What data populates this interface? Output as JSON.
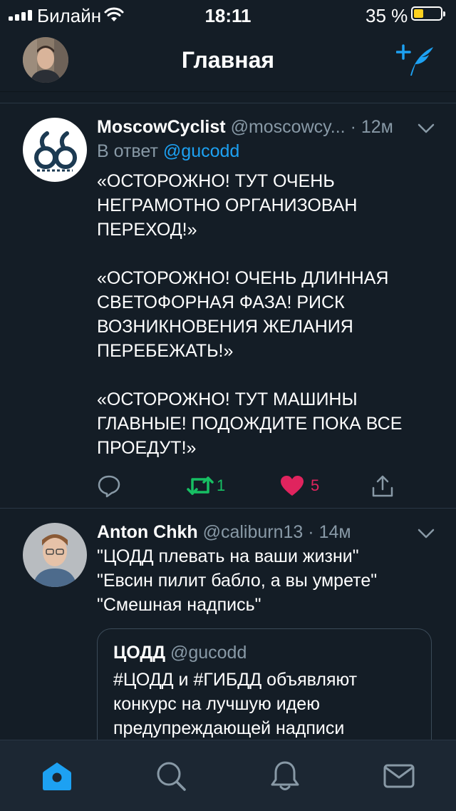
{
  "status_bar": {
    "carrier": "Билайн",
    "time": "18:11",
    "battery_percent": "35 %",
    "battery_level": 0.35,
    "battery_color": "#fdd11f"
  },
  "nav": {
    "title": "Главная",
    "profile_icon": "avatar",
    "compose_icon": "compose-tweet-icon",
    "accent": "#1da1f2"
  },
  "tweets": [
    {
      "name": "MoscowCyclist",
      "handle": "@moscowcy...",
      "time": "12м",
      "reply_prefix": "В ответ",
      "reply_to": "@gucodd",
      "paragraphs": [
        "«ОСТОРОЖНО! ТУТ ОЧЕНЬ НЕГРАМОТНО ОРГАНИЗОВАН ПЕРЕХОД!»",
        "«ОСТОРОЖНО! ОЧЕНЬ ДЛИННАЯ СВЕТОФОРНАЯ ФАЗА! РИСК ВОЗНИКНОВЕНИЯ ЖЕЛАНИЯ ПЕРЕБЕЖАТЬ!»",
        "«ОСТОРОЖНО! ТУТ МАШИНЫ ГЛАВНЫЕ! ПОДОЖДИТЕ ПОКА ВСЕ ПРОЕДУТ!»"
      ],
      "retweets": "1",
      "likes": "5"
    },
    {
      "name": "Anton Chkh",
      "handle": "@caliburn13",
      "time": "14м",
      "paragraphs": [
        "\"ЦОДД плевать на ваши жизни\"",
        "\"Евсин пилит бабло, а вы умрете\"",
        "\"Смешная надпись\""
      ],
      "quote": {
        "name": "ЦОДД",
        "handle": "@gucodd",
        "lines": [
          "#ЦОДД и #ГИБДД  объявляют",
          "конкурс на лучшую идею",
          "предупреждающей надписи"
        ]
      }
    }
  ],
  "colors": {
    "background": "#141d26",
    "secondary_text": "#8899a6",
    "retweet": "#17bf63",
    "like": "#e0245e",
    "tab_active": "#1da1f2"
  },
  "tabbar": {
    "tabs": [
      "home-icon",
      "search-icon",
      "notifications-icon",
      "messages-icon"
    ],
    "active": "home-icon"
  }
}
